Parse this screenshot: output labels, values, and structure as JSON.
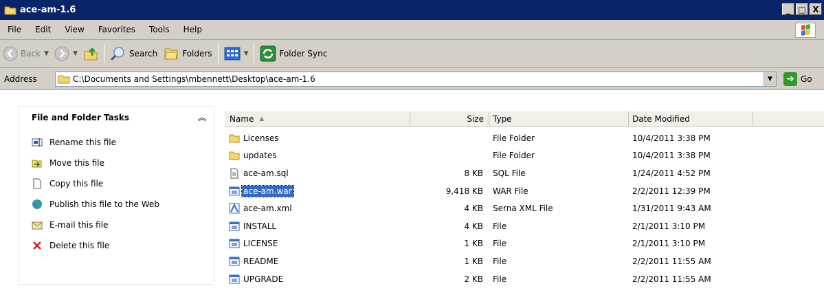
{
  "window": {
    "title": "ace-am-1.6",
    "minimize_label": "_",
    "maximize_label": "□",
    "close_label": "X"
  },
  "menu": [
    "File",
    "Edit",
    "View",
    "Favorites",
    "Tools",
    "Help"
  ],
  "toolbar": {
    "back_label": "Back",
    "search_label": "Search",
    "folders_label": "Folders",
    "folder_sync_label": "Folder Sync"
  },
  "address": {
    "label": "Address",
    "value": "C:\\Documents and Settings\\mbennett\\Desktop\\ace-am-1.6",
    "go_label": "Go"
  },
  "tasks": {
    "title": "File and Folder Tasks",
    "items": [
      {
        "label": "Rename this file",
        "icon": "rename-icon"
      },
      {
        "label": "Move this file",
        "icon": "move-icon"
      },
      {
        "label": "Copy this file",
        "icon": "copy-icon"
      },
      {
        "label": "Publish this file to the Web",
        "icon": "globe-icon"
      },
      {
        "label": "E-mail this file",
        "icon": "email-icon"
      },
      {
        "label": "Delete this file",
        "icon": "delete-icon"
      }
    ]
  },
  "columns": {
    "name": "Name",
    "size": "Size",
    "type": "Type",
    "date": "Date Modified"
  },
  "files": [
    {
      "name": "Licenses",
      "size": "",
      "type": "File Folder",
      "date": "10/4/2011 3:38 PM",
      "icon": "folder-icon",
      "selected": false
    },
    {
      "name": "updates",
      "size": "",
      "type": "File Folder",
      "date": "10/4/2011 3:38 PM",
      "icon": "folder-icon",
      "selected": false
    },
    {
      "name": "ace-am.sql",
      "size": "8 KB",
      "type": "SQL File",
      "date": "1/24/2011 4:52 PM",
      "icon": "text-file-icon",
      "selected": false
    },
    {
      "name": "ace-am.war",
      "size": "9,418 KB",
      "type": "WAR File",
      "date": "2/2/2011 12:39 PM",
      "icon": "generic-file-icon",
      "selected": true
    },
    {
      "name": "ace-am.xml",
      "size": "4 KB",
      "type": "Serna XML File",
      "date": "1/31/2011 9:43 AM",
      "icon": "xml-file-icon",
      "selected": false
    },
    {
      "name": "INSTALL",
      "size": "4 KB",
      "type": "File",
      "date": "2/1/2011 3:10 PM",
      "icon": "generic-file-icon",
      "selected": false
    },
    {
      "name": "LICENSE",
      "size": "1 KB",
      "type": "File",
      "date": "2/1/2011 3:10 PM",
      "icon": "generic-file-icon",
      "selected": false
    },
    {
      "name": "README",
      "size": "1 KB",
      "type": "File",
      "date": "2/2/2011 11:55 AM",
      "icon": "generic-file-icon",
      "selected": false
    },
    {
      "name": "UPGRADE",
      "size": "2 KB",
      "type": "File",
      "date": "2/2/2011 11:55 AM",
      "icon": "generic-file-icon",
      "selected": false
    }
  ],
  "colors": {
    "titlebar": "#0a246a",
    "selection": "#316ac5",
    "chrome": "#d4d0c8"
  }
}
